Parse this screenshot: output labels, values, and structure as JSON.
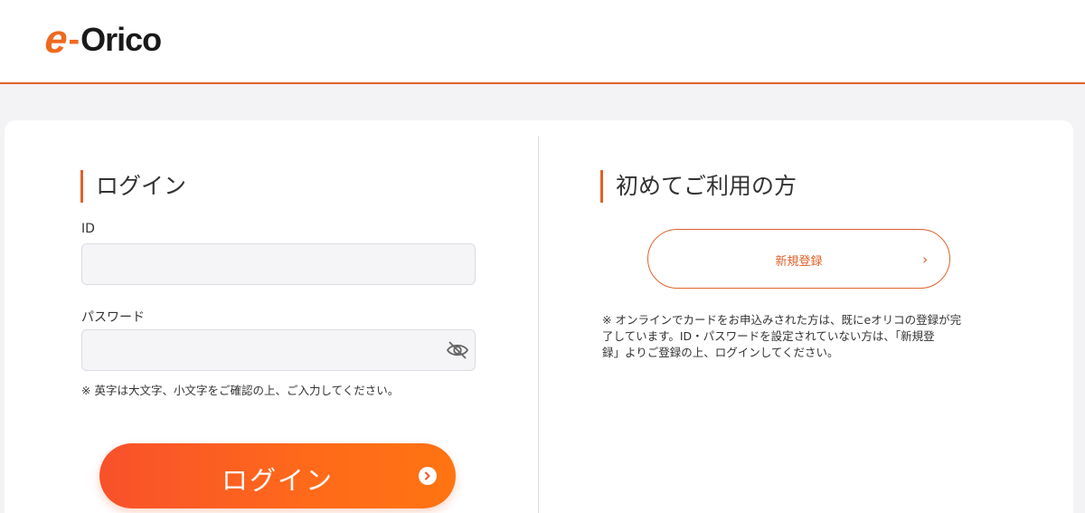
{
  "header": {
    "logo_e": "e",
    "logo_dash": "-",
    "logo_name": "Orico"
  },
  "login": {
    "title": "ログイン",
    "id_label": "ID",
    "id_value": "",
    "password_label": "パスワード",
    "password_value": "",
    "note": "※ 英字は大文字、小文字をご確認の上、ご入力してください。",
    "button_label": "ログイン"
  },
  "first_time": {
    "title": "初めてご利用の方",
    "register_label": "新規登録",
    "register_chevron": "›",
    "note_lines": [
      "※ オンラインでカードをお申込みされた方は、既にeオリコの登録が完",
      "了しています。ID・パスワードを設定されていない方は、「新規登",
      "録」よりご登録の上、ログインしてください。"
    ]
  },
  "colors": {
    "accent": "#e0622a",
    "button_start": "#f8512b",
    "button_end": "#ff7412",
    "background": "#f3f3f6"
  },
  "icons": {
    "password_toggle": "eye-slash-icon",
    "login_arrow": "chevron-right-circle-icon",
    "register_arrow": "chevron-right-icon"
  }
}
